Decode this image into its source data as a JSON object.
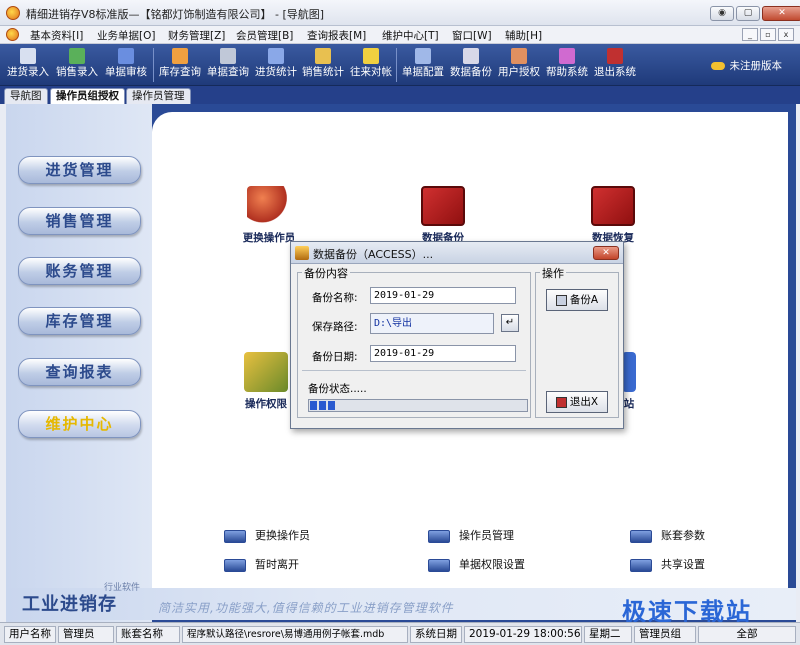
{
  "window": {
    "title": "精细进销存V8标准版—【铭都灯饰制造有限公司】 - [导航图]",
    "controls": [
      "◉",
      "▢",
      "✕"
    ]
  },
  "menubar": {
    "items": [
      "基本资料[I]",
      "业务单据[O]",
      "财务管理[Z]",
      "会员管理[B]",
      "查询报表[M]",
      "维护中心[T]",
      "窗口[W]",
      "辅助[H]"
    ],
    "mdi_controls": [
      "_",
      "▫",
      "x"
    ]
  },
  "toolbar": {
    "buttons": [
      "进货录入",
      "销售录入",
      "单据审核",
      "库存查询",
      "单据查询",
      "进货统计",
      "销售统计",
      "往来对帐",
      "单据配置",
      "数据备份",
      "用户授权",
      "帮助系统",
      "退出系统"
    ],
    "unregistered": "未注册版本"
  },
  "tabs": [
    "导航图",
    "操作员组授权",
    "操作员管理"
  ],
  "nav": {
    "items": [
      "进货管理",
      "销售管理",
      "账务管理",
      "库存管理",
      "查询报表",
      "维护中心"
    ],
    "active_index": 5
  },
  "big_icons": [
    "更换操作员",
    "数据备份",
    "数据恢复",
    "操作权限",
    "站"
  ],
  "sub_links": [
    "更换操作员",
    "操作员管理",
    "账套参数",
    "暂时离开",
    "单据权限设置",
    "共享设置"
  ],
  "brand": {
    "caption": "行业软件",
    "name": "工业进销存",
    "slogan": "简洁实用,功能强大,值得信赖的工业进销存管理软件"
  },
  "watermark": "极速下载站",
  "dialog": {
    "title": "数据备份（ACCESS）...",
    "close": "✕",
    "group_content": "备份内容",
    "group_actions": "操作",
    "name_label": "备份名称:",
    "name_value": "2019-01-29",
    "path_label": "保存路径:",
    "path_value": "D:\\导出",
    "browse": "↵",
    "date_label": "备份日期:",
    "date_value": "2019-01-29",
    "status_label": "备份状态.....",
    "progress": 0.12,
    "backup_button": "备份A",
    "exit_button": "退出X"
  },
  "statusbar": {
    "cells": [
      "用户名称",
      "管理员",
      "账套名称",
      "程序默认路径\\resrore\\易博通用例子帐套.mdb",
      "系统日期",
      "2019-01-29  18:00:56",
      "星期二",
      "管理员组",
      "全部"
    ]
  },
  "colors": {
    "toolbar_bg": "#1f3a7a",
    "workspace_bg": "#2a4a96",
    "nav_text": "#2c4a8c",
    "nav_active_text": "#e6b800"
  }
}
